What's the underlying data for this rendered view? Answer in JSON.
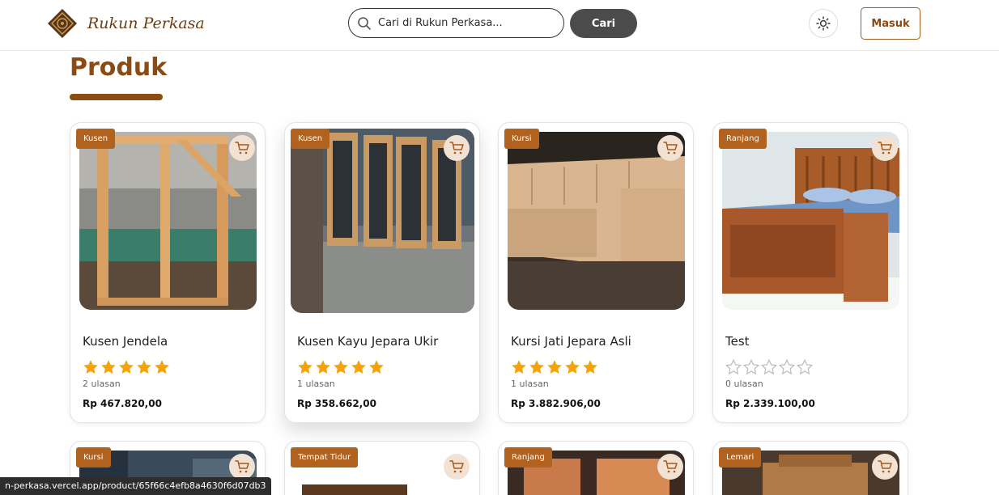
{
  "header": {
    "brand_name": "Rukun Perkasa",
    "search_placeholder": "Cari di Rukun Perkasa...",
    "search_button": "Cari",
    "login_button": "Masuk"
  },
  "page": {
    "title": "Produk"
  },
  "products": [
    {
      "category": "Kusen",
      "name": "Kusen Jendela",
      "rating": 5,
      "reviews": "2 ulasan",
      "price": "Rp 467.820,00"
    },
    {
      "category": "Kusen",
      "name": "Kusen Kayu Jepara Ukir",
      "rating": 5,
      "reviews": "1 ulasan",
      "price": "Rp 358.662,00"
    },
    {
      "category": "Kursi",
      "name": "Kursi Jati Jepara Asli",
      "rating": 5,
      "reviews": "1 ulasan",
      "price": "Rp 3.882.906,00"
    },
    {
      "category": "Ranjang",
      "name": "Test",
      "rating": 0,
      "reviews": "0 ulasan",
      "price": "Rp 2.339.100,00"
    }
  ],
  "products_row2": [
    {
      "category": "Kursi"
    },
    {
      "category": "Tempat Tidur"
    },
    {
      "category": "Ranjang"
    },
    {
      "category": "Lemari"
    }
  ],
  "status_url": "n-perkasa.vercel.app/product/65f66c4efb8a4630f6d07db3",
  "colors": {
    "accent": "#8b4b12",
    "badge": "#b0621e",
    "star": "#f4a30b",
    "star_empty": "#bdbdbd"
  }
}
